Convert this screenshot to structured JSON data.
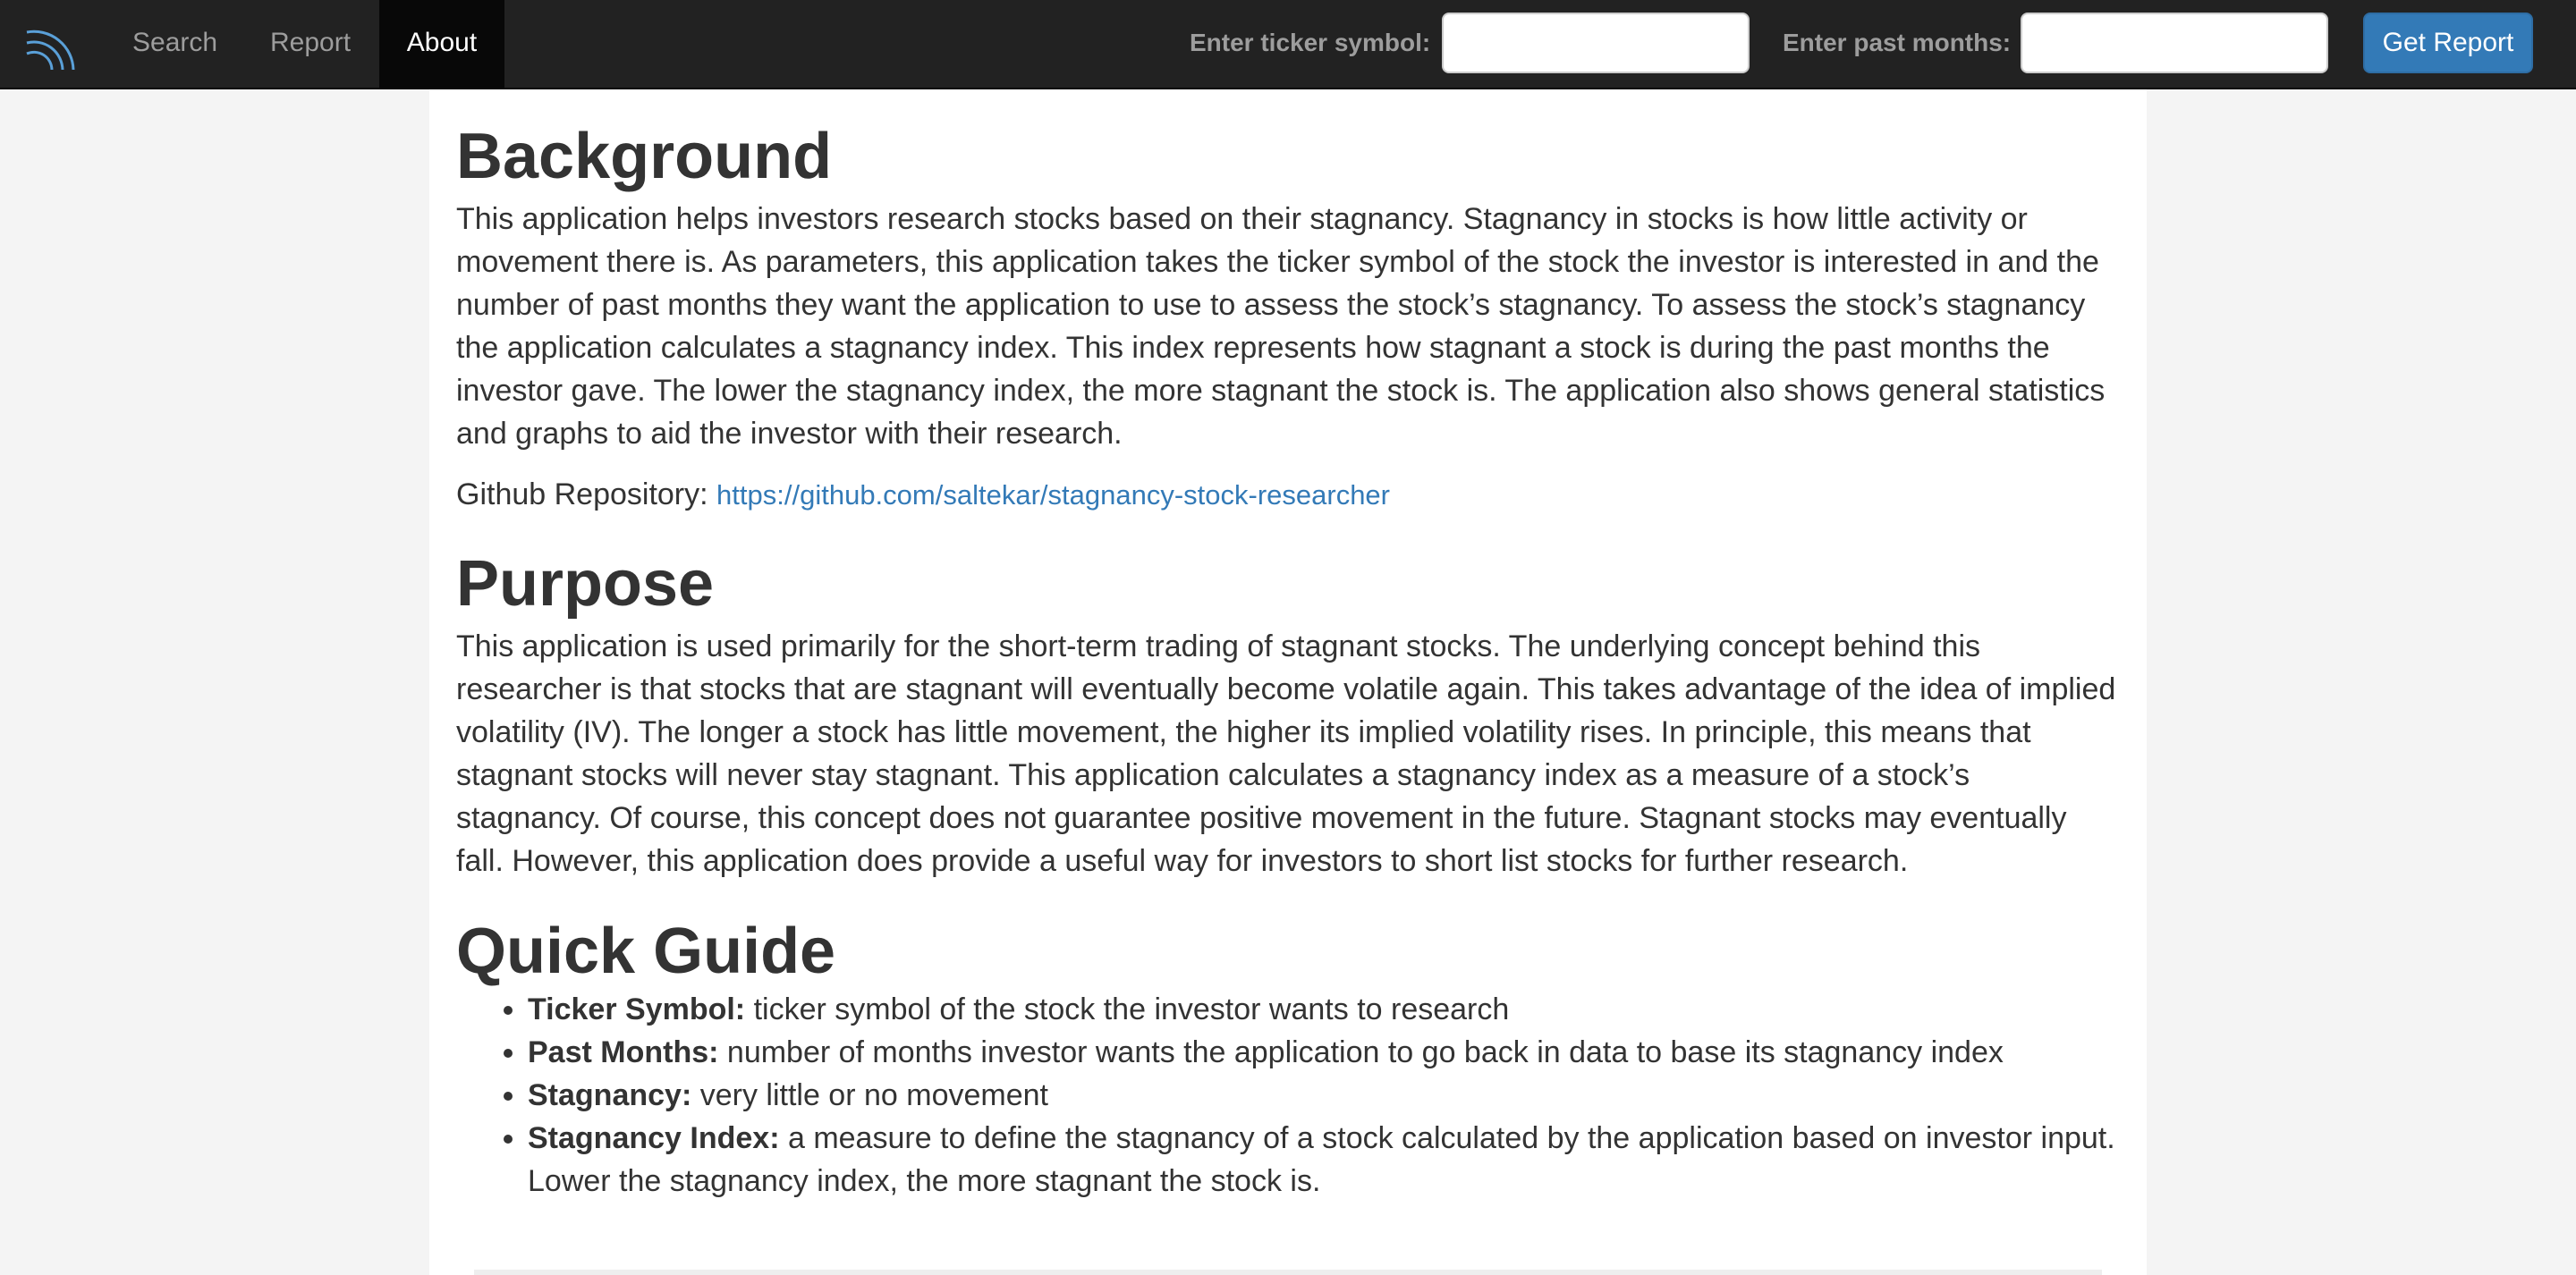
{
  "nav": {
    "items": [
      {
        "label": "Search"
      },
      {
        "label": "Report"
      },
      {
        "label": "About"
      }
    ],
    "ticker_label": "Enter ticker symbol:",
    "ticker_value": "",
    "months_label": "Enter past months:",
    "months_value": "",
    "button_label": "Get Report"
  },
  "colors": {
    "navbar": "#222222",
    "active_tab": "#080808",
    "accent": "#337ab7",
    "link": "#337ab7"
  },
  "icons": {
    "brand": "signal-arcs-icon"
  },
  "content": {
    "background": {
      "heading": "Background",
      "body": "This application helps investors research stocks based on their stagnancy. Stagnancy in stocks is how little activity or movement there is. As parameters, this application takes the ticker symbol of the stock the investor is interested in and the number of past months they want the application to use to assess the stock’s stagnancy. To assess the stock’s stagnancy the application calculates a stagnancy index. This index represents how stagnant a stock is during the past months the investor gave. The lower the stagnancy index, the more stagnant the stock is. The application also shows general statistics and graphs to aid the investor with their research.",
      "repo_label": "Github Repository:",
      "repo_url": "https://github.com/saltekar/stagnancy-stock-researcher"
    },
    "purpose": {
      "heading": "Purpose",
      "body": "This application is used primarily for the short-term trading of stagnant stocks. The underlying concept behind this researcher is that stocks that are stagnant will eventually become volatile again. This takes advantage of the idea of implied volatility (IV). The longer a stock has little movement, the higher its implied volatility rises. In principle, this means that stagnant stocks will never stay stagnant. This application calculates a stagnancy index as a measure of a stock’s stagnancy. Of course, this concept does not guarantee positive movement in the future. Stagnant stocks may eventually fall. However, this application does provide a useful way for investors to short list stocks for further research."
    },
    "guide": {
      "heading": "Quick Guide",
      "items": [
        {
          "term": "Ticker Symbol:",
          "desc": "ticker symbol of the stock the investor wants to research"
        },
        {
          "term": "Past Months:",
          "desc": "number of months investor wants the application to go back in data to base its stagnancy index"
        },
        {
          "term": "Stagnancy:",
          "desc": "very little or no movement"
        },
        {
          "term": "Stagnancy Index:",
          "desc": "a measure to define the stagnancy of a stock calculated by the application based on investor input. Lower the stagnancy index, the more stagnant the stock is."
        }
      ]
    }
  }
}
